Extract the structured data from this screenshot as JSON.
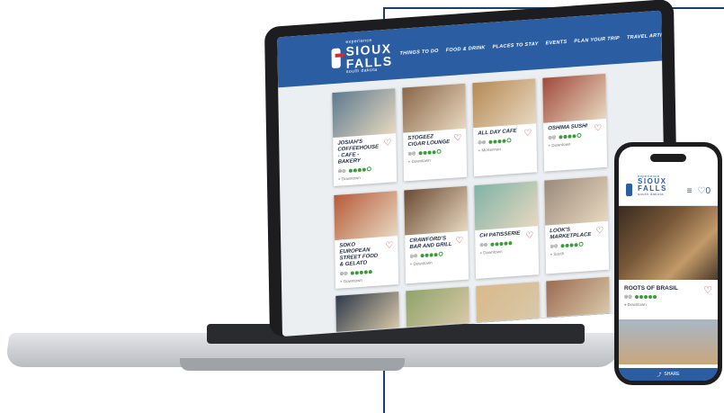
{
  "site": {
    "logo_small": "experience",
    "logo_big": "SIOUX FALLS",
    "logo_tag": "south dakota",
    "nav": [
      "THINGS TO DO",
      "FOOD & DRINK",
      "PLACES TO STAY",
      "EVENTS",
      "PLAN YOUR TRIP",
      "TRAVEL ARTICLES"
    ],
    "fav_count": "0"
  },
  "cards_row1": [
    {
      "title": "JOSIAH'S COFFEEHOUSE - CAFE - BAKERY",
      "rating": 4,
      "location": "Downtown",
      "img": "#5c7a8f"
    },
    {
      "title": "STOGEEZ CIGAR LOUNGE",
      "rating": 4,
      "location": "Downtown",
      "img": "#8a6748"
    },
    {
      "title": "ALL DAY CAFE",
      "rating": 4,
      "location": "McKennan",
      "img": "#b58955"
    },
    {
      "title": "OSHIMA SUSHI",
      "rating": 4,
      "location": "Downtown",
      "img": "#a04a3a"
    }
  ],
  "cards_row2": [
    {
      "title": "SOKO EUROPEAN STREET FOOD & GELATO",
      "rating": 5,
      "location": "Downtown",
      "img": "#b65b3a"
    },
    {
      "title": "CRAWFORD'S BAR AND GRILL",
      "rating": 4,
      "location": "Downtown",
      "img": "#6a4a32"
    },
    {
      "title": "CH PATISSERIE",
      "rating": 5,
      "location": "Downtown",
      "img": "#7fb3a6"
    },
    {
      "title": "LOOK'S MARKETPLACE",
      "rating": 4,
      "location": "South",
      "img": "#9a8a7a"
    }
  ],
  "cards_row3_imgs": [
    "#2f3a4a",
    "#8fa36a",
    "#d9b98a",
    "#9d6b52"
  ],
  "phone": {
    "card_title": "ROOTS OF BRASIL",
    "rating": 5,
    "location": "Downtown",
    "footer": "SHARE",
    "fav_count": "0"
  },
  "colors": {
    "brand_blue": "#2b5da3",
    "heart_red": "#c8312f",
    "rating_green": "#3a9b3a"
  }
}
